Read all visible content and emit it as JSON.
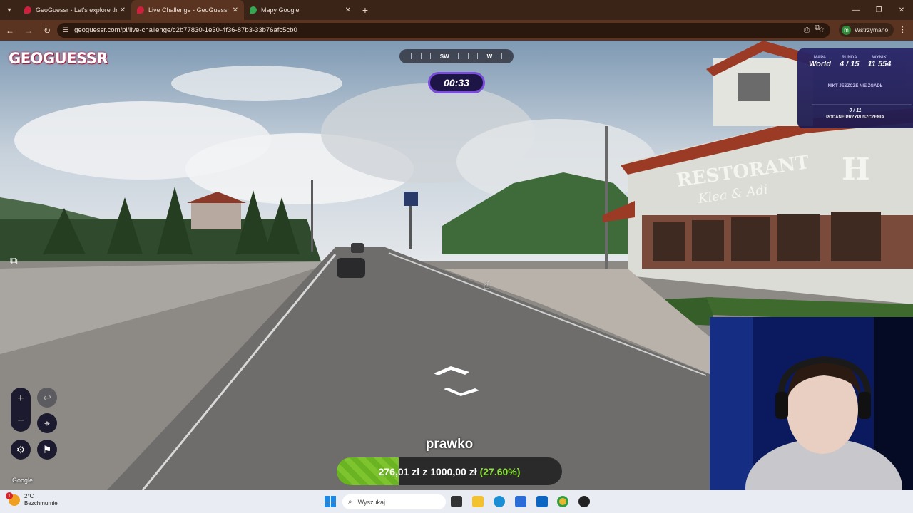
{
  "browser": {
    "tabs": [
      {
        "title": "GeoGuessr - Let's explore the w",
        "active": false
      },
      {
        "title": "Live Challenge - GeoGuessr",
        "active": true
      },
      {
        "title": "Mapy Google",
        "active": false
      }
    ],
    "url": "geoguessr.com/pl/live-challenge/c2b77830-1e30-4f36-87b3-33b76afc5cb0",
    "profile_initial": "m",
    "profile_label": "Wstrzymano"
  },
  "game": {
    "logo": "GEOGUESSR",
    "compass": {
      "left": "SW",
      "right": "W"
    },
    "timer": "00:33",
    "panel": {
      "map_label": "MAPA",
      "map_value": "World",
      "round_label": "RUNDA",
      "round_value": "4 / 15",
      "score_label": "WYNIK",
      "score_value": "11 554",
      "nobody_guessed": "NIKT JESZCZE NIE ZGADŁ",
      "pins_count": "0 / 11",
      "pins_label": "PODANE PRZYPUSZCZENIA"
    },
    "attribution": "Google",
    "player_name": "prawko",
    "balance": {
      "current": "276,01 zł",
      "connector": "z",
      "target": "1000,00 zł",
      "percent": "(27.60%)",
      "fraction": 0.276
    }
  },
  "scene": {
    "restaurant_sign": "RESTORANT",
    "restaurant_sub": "Klea & Adi",
    "hotel_letter": "H"
  },
  "taskbar": {
    "weather_temp": "2°C",
    "weather_desc": "Bezchmurnie",
    "weather_badge": "1",
    "search_placeholder": "Wyszukaj"
  },
  "colors": {
    "accent": "#7a4bdc",
    "progress": "#7ec42f",
    "chrome": "#5a3420"
  }
}
